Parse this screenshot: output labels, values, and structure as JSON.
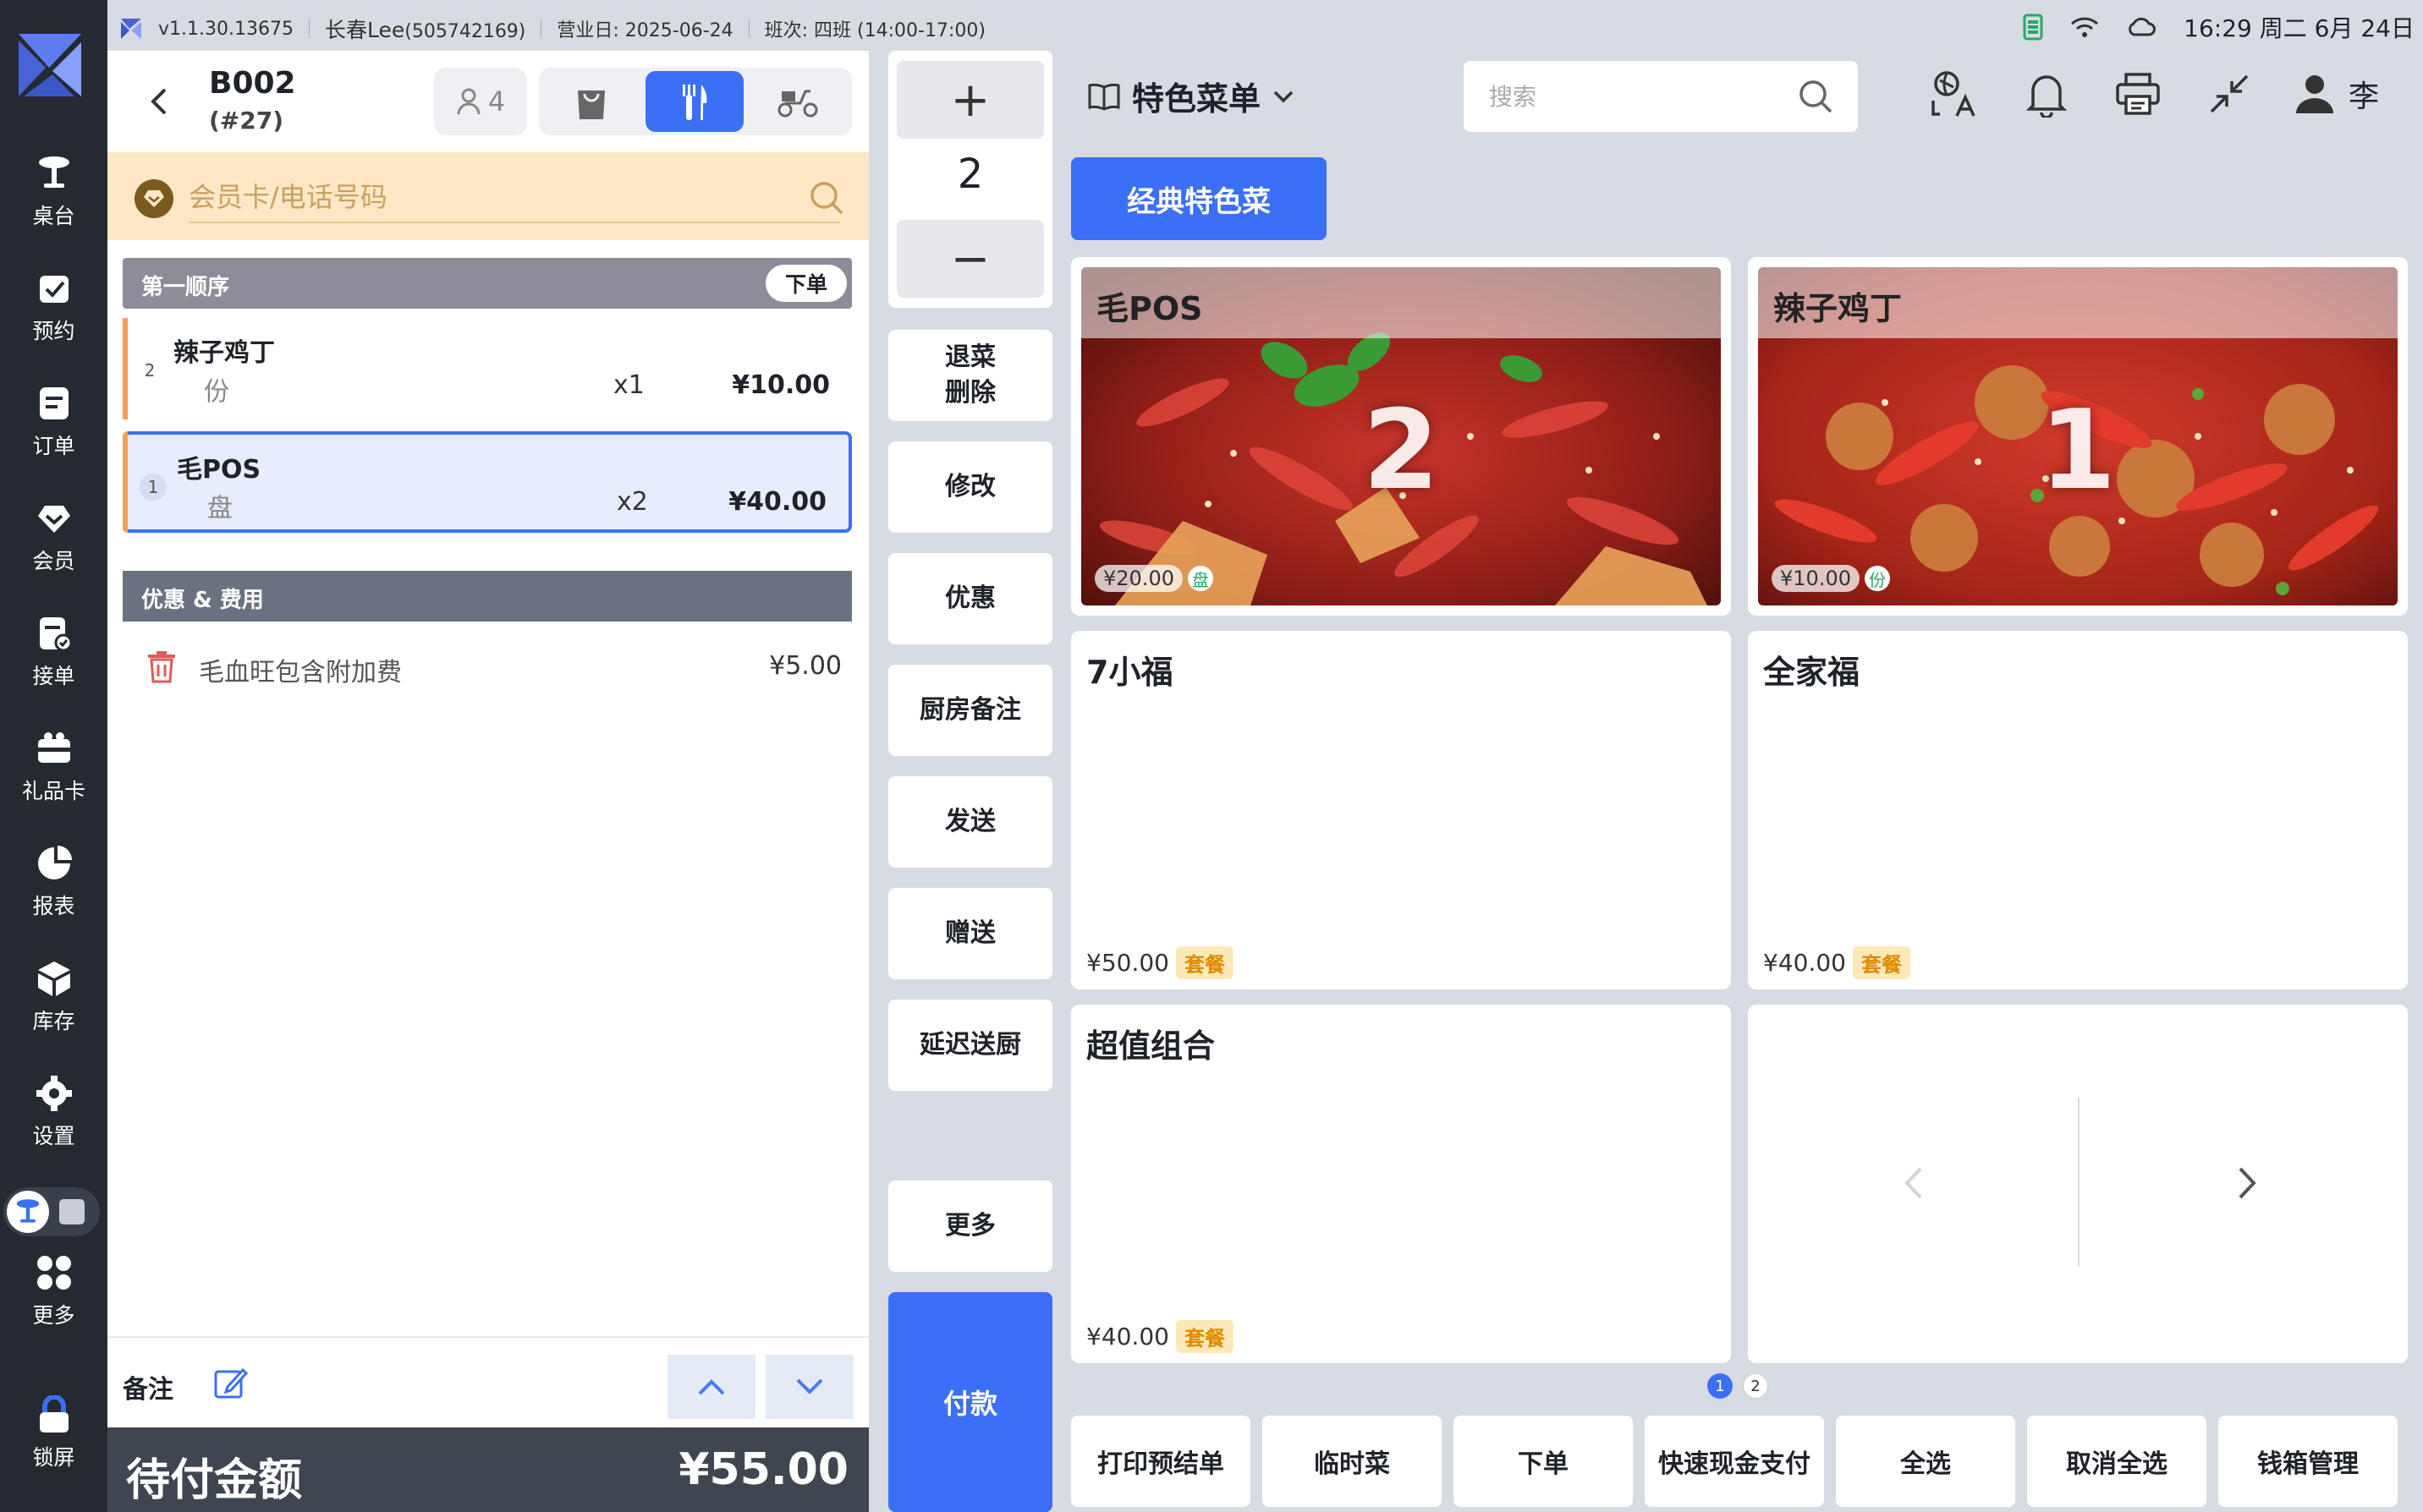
{
  "nav": {
    "items": [
      {
        "label": "桌台",
        "icon": "table-icon"
      },
      {
        "label": "预约",
        "icon": "reservation-icon"
      },
      {
        "label": "订单",
        "icon": "orders-icon"
      },
      {
        "label": "会员",
        "icon": "member-icon"
      },
      {
        "label": "接单",
        "icon": "accept-order-icon"
      },
      {
        "label": "礼品卡",
        "icon": "gift-card-icon"
      },
      {
        "label": "报表",
        "icon": "report-icon"
      },
      {
        "label": "库存",
        "icon": "inventory-icon"
      },
      {
        "label": "设置",
        "icon": "settings-icon"
      },
      {
        "label": "更多",
        "icon": "more-icon"
      },
      {
        "label": "锁屏",
        "icon": "lock-icon"
      }
    ]
  },
  "statusbar": {
    "version": "v1.1.30.13675",
    "user": "长春Lee",
    "user_id": "(505742169)",
    "business_day": "营业日: 2025-06-24",
    "shift": "班次: 四班 (14:00-17:00)",
    "clock": "16:29 周二 6月 24日"
  },
  "order": {
    "table": "B002",
    "seq": "(#27)",
    "guests": "4",
    "member_placeholder": "会员卡/电话号码",
    "course": {
      "title": "第一顺序",
      "submit": "下单"
    },
    "items": [
      {
        "idx": "2",
        "name": "辣子鸡丁",
        "unit": "份",
        "qty": "x1",
        "price": "¥10.00"
      },
      {
        "idx": "1",
        "name": "毛POS",
        "unit": "盘",
        "qty": "x2",
        "price": "¥40.00"
      }
    ],
    "fees_title": "优惠 & 费用",
    "fee": {
      "name": "毛血旺包含附加费",
      "amount": "¥5.00"
    },
    "note_label": "备注",
    "total_label": "待付金额",
    "total": "¥55.00"
  },
  "actions": {
    "plus": "+",
    "minus": "−",
    "qty": "2",
    "refund_line1": "退菜",
    "refund_line2": "删除",
    "modify": "修改",
    "discount": "优惠",
    "kitchen_note": "厨房备注",
    "send": "发送",
    "gift": "赠送",
    "delay": "延迟送厨",
    "more": "更多",
    "pay": "付款"
  },
  "menu": {
    "title": "特色菜单",
    "search_placeholder": "搜索",
    "user_name": "李",
    "category": "经典特色菜",
    "dishes": [
      {
        "name": "毛POS",
        "count": "2",
        "price": "¥20.00",
        "unit": "盘"
      },
      {
        "name": "辣子鸡丁",
        "count": "1",
        "price": "¥10.00",
        "unit": "份"
      }
    ],
    "combos": [
      {
        "name": "7小福",
        "price": "¥50.00",
        "badge": "套餐"
      },
      {
        "name": "全家福",
        "price": "¥40.00",
        "badge": "套餐"
      },
      {
        "name": "超值组合",
        "price": "¥40.00",
        "badge": "套餐"
      }
    ],
    "pages": [
      "1",
      "2"
    ],
    "bottom": [
      "打印预结单",
      "临时菜",
      "下单",
      "快速现金支付",
      "全选",
      "取消全选",
      "钱箱管理"
    ]
  },
  "colors": {
    "accent": "#3b6ff5",
    "nav_bg": "#252a31",
    "member_bg": "#fde8c6",
    "item_bar": "#f3a056"
  }
}
